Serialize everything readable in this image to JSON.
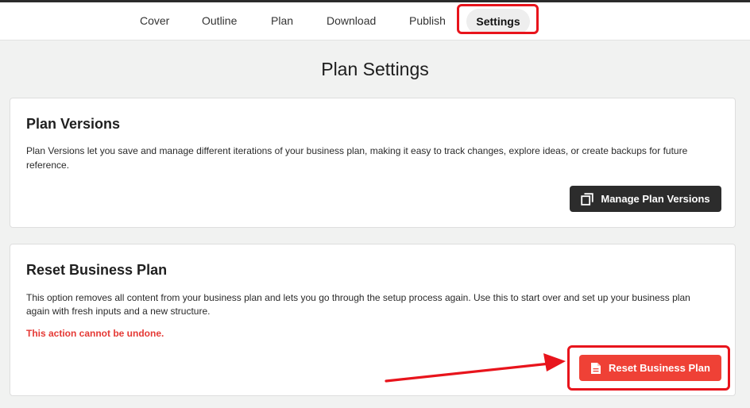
{
  "nav": {
    "tabs": [
      "Cover",
      "Outline",
      "Plan",
      "Download",
      "Publish"
    ],
    "active_tab": "Settings"
  },
  "page": {
    "title": "Plan Settings"
  },
  "plan_versions": {
    "title": "Plan Versions",
    "description_line1": "Plan Versions let you save and manage different iterations of your business plan, making it easy to track changes, explore ideas, or create backups for future",
    "description_line2": "reference.",
    "button_label": "Manage Plan Versions",
    "button_icon": "copy-icon"
  },
  "reset_plan": {
    "title": "Reset Business Plan",
    "description_line1": "This option removes all content from your business plan and lets you go through the setup process again. Use this to start over and set up your business plan",
    "description_line2": "again with fresh inputs and a new structure.",
    "warning": "This action cannot be undone.",
    "button_label": "Reset Business Plan",
    "button_icon": "document-icon"
  },
  "colors": {
    "annotation": "#e8141c",
    "danger_button": "#ef4136",
    "warning_text": "#e53935",
    "dark_button": "#2c2c2c"
  }
}
